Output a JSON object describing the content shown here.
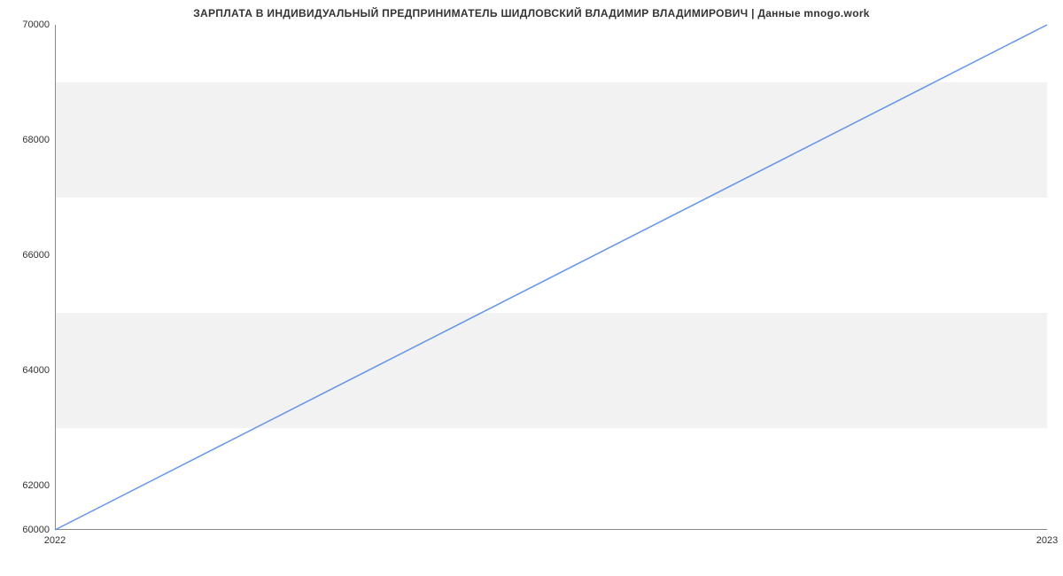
{
  "chart_data": {
    "type": "line",
    "title": "ЗАРПЛАТА В ИНДИВИДУАЛЬНЫЙ ПРЕДПРИНИМАТЕЛЬ ШИДЛОВСКИЙ ВЛАДИМИР ВЛАДИМИРОВИЧ | Данные mnogo.work",
    "x": [
      2022,
      2023
    ],
    "values": [
      60000,
      70000
    ],
    "xlabel": "",
    "ylabel": "",
    "ylim": [
      60000,
      70000
    ],
    "xlim": [
      2022,
      2023
    ],
    "y_ticks": [
      60000,
      62000,
      64000,
      66000,
      68000,
      70000
    ],
    "x_ticks": [
      2022,
      2023
    ],
    "line_color": "#6495ed",
    "band_color": "#f2f2f2"
  }
}
